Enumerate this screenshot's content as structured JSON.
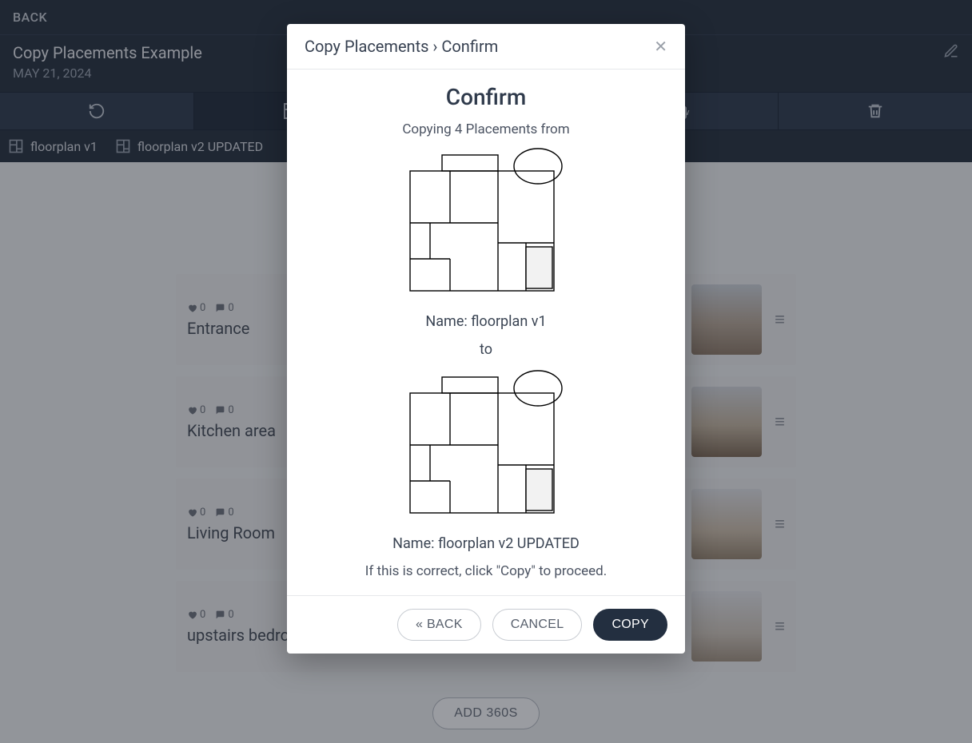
{
  "backbar": {
    "label": "BACK"
  },
  "titlebar": {
    "title": "Copy Placements Example",
    "date": "MAY 21, 2024"
  },
  "tabs": [
    {
      "label": "floorplan v1"
    },
    {
      "label": "floorplan v2 UPDATED"
    }
  ],
  "rows": [
    {
      "name": "Entrance",
      "hearts": "0",
      "comments": "0"
    },
    {
      "name": "Kitchen area",
      "hearts": "0",
      "comments": "0"
    },
    {
      "name": "Living Room",
      "hearts": "0",
      "comments": "0"
    },
    {
      "name": "upstairs bedroom",
      "hearts": "0",
      "comments": "0"
    }
  ],
  "add360": {
    "label": "ADD 360S"
  },
  "modal": {
    "breadcrumb": "Copy Placements › Confirm",
    "heading": "Confirm",
    "copying_line": "Copying 4 Placements from",
    "source_name_label": "Name: floorplan v1",
    "to_label": "to",
    "target_name_label": "Name: floorplan v2 UPDATED",
    "instruction": "If this is correct, click \"Copy\" to proceed.",
    "buttons": {
      "back": "«  BACK",
      "cancel": "CANCEL",
      "copy": "COPY"
    }
  }
}
